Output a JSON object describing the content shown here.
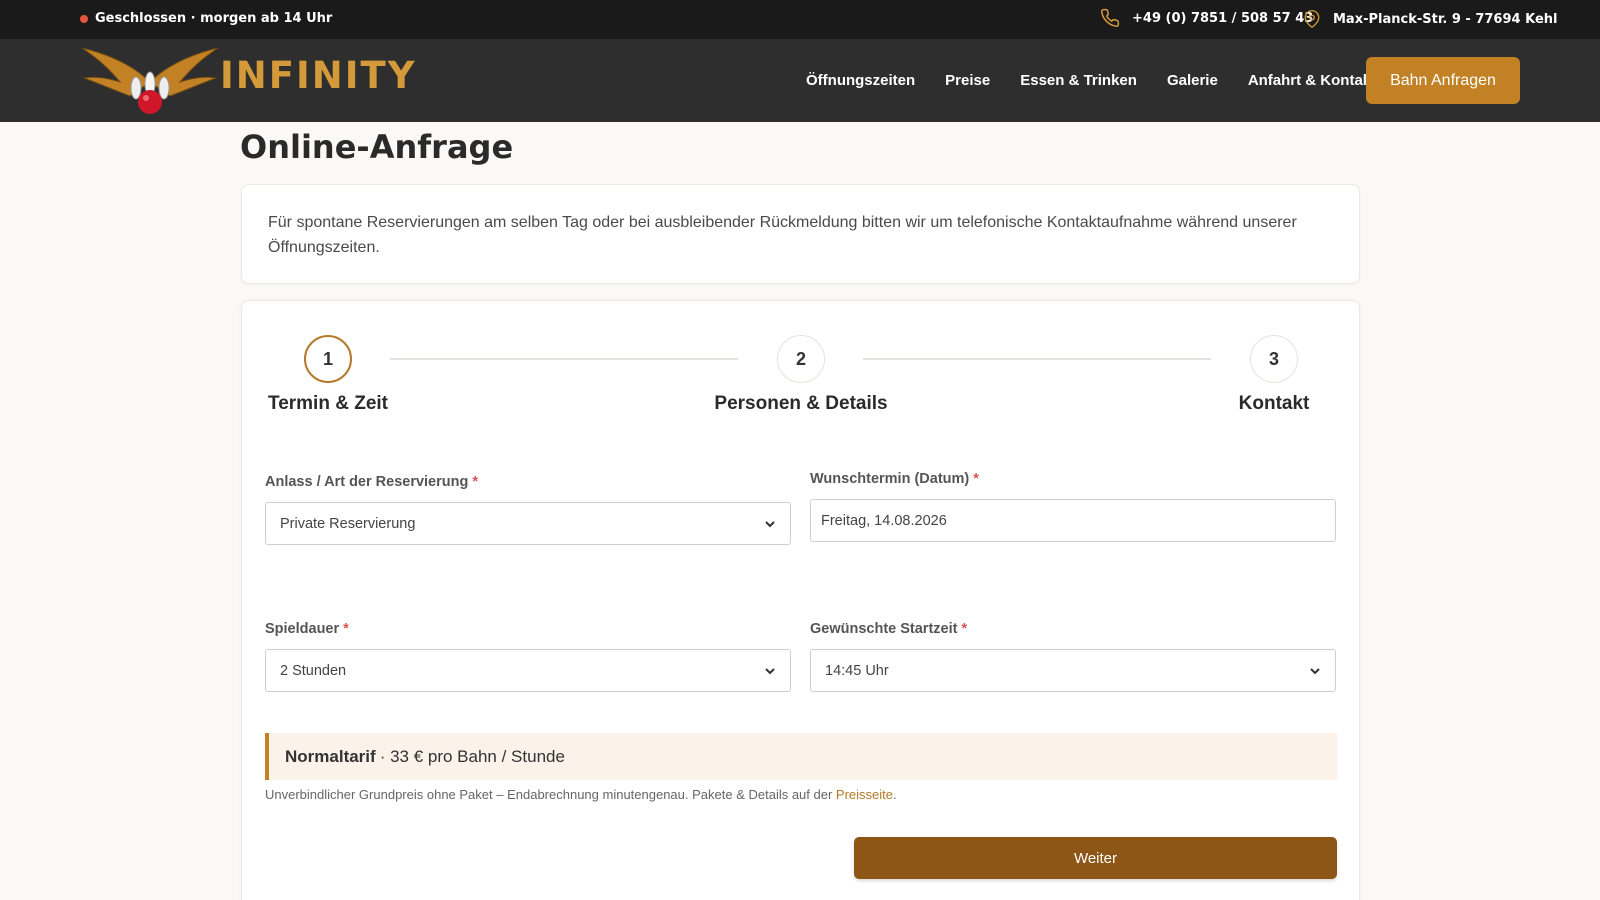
{
  "topbar": {
    "status": "Geschlossen · morgen ab 14 Uhr",
    "phone": "+49 (0) 7851 / 508 57 43",
    "address": "Max-Planck-Str. 9 - 77694 Kehl"
  },
  "header": {
    "logo_text": "INFINITY",
    "nav": [
      "Öffnungszeiten",
      "Preise",
      "Essen & Trinken",
      "Galerie",
      "Anfahrt & Kontakt"
    ],
    "cta": "Bahn Anfragen"
  },
  "page": {
    "title": "Online-Anfrage",
    "notice": "Für spontane Reservierungen am selben Tag oder bei ausbleibender Rückmeldung bitten wir um telefonische Kontaktaufnahme während unserer Öffnungszeiten."
  },
  "steps": [
    {
      "number": "1",
      "label": "Termin & Zeit"
    },
    {
      "number": "2",
      "label": "Personen & Details"
    },
    {
      "number": "3",
      "label": "Kontakt"
    }
  ],
  "form": {
    "anlass": {
      "label": "Anlass / Art der Reservierung",
      "value": "Private Reservierung"
    },
    "datum": {
      "label": "Wunschtermin (Datum)",
      "value": "Freitag, 14.08.2026"
    },
    "dauer": {
      "label": "Spieldauer",
      "value": "2 Stunden"
    },
    "startzeit": {
      "label": "Gewünschte Startzeit",
      "value": "14:45 Uhr"
    },
    "required_mark": "*"
  },
  "tarif": {
    "name": "Normaltarif",
    "price": "· 33 € pro Bahn / Stunde",
    "hint_text": "Unverbindlicher Grundpreis ohne Paket – Endabrechnung minutengenau. Pakete & Details auf der ",
    "hint_link": "Preisseite",
    "hint_end": "."
  },
  "next_button": "Weiter",
  "colors": {
    "accent": "#c28125",
    "button_dark": "#8e5616",
    "required": "#d9534f"
  }
}
